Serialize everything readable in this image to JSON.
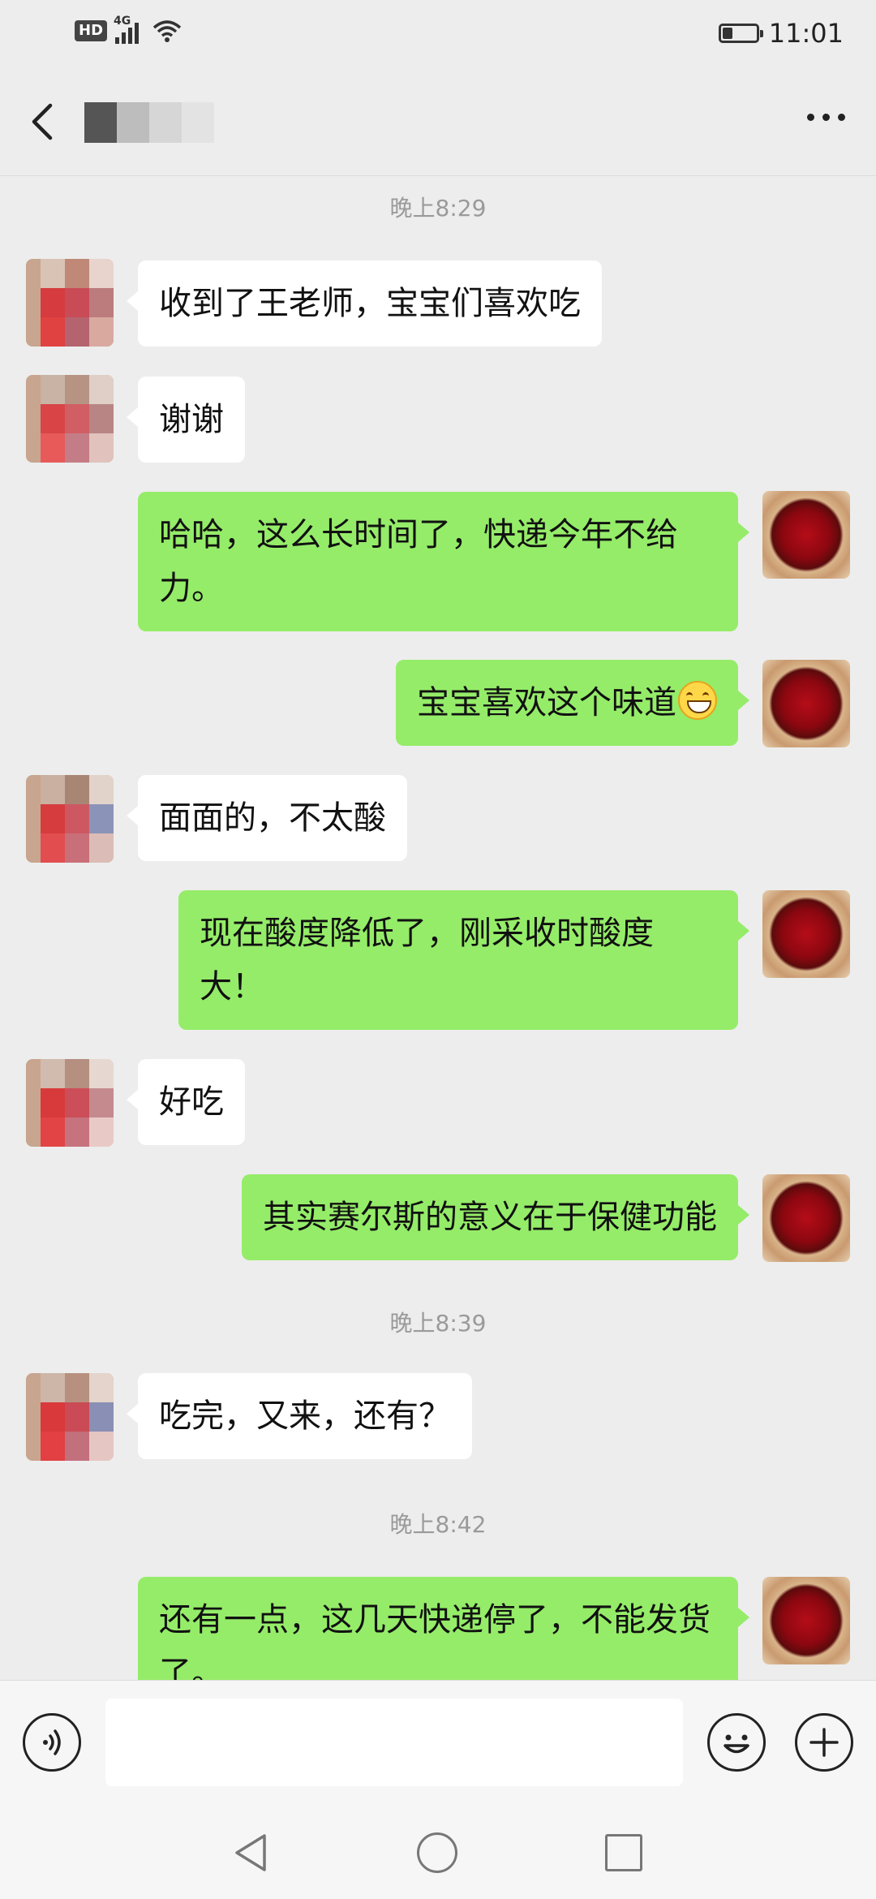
{
  "status_bar": {
    "hd_label": "HD",
    "network_label": "4G",
    "time": "11:01"
  },
  "header": {
    "back_icon": "chevron-left-icon",
    "more_icon": "more-dots-icon"
  },
  "colors": {
    "background": "#ededed",
    "sent_bubble": "#95ec69",
    "received_bubble": "#ffffff",
    "timestamp": "#9a9a9a"
  },
  "messages": [
    {
      "type": "timestamp",
      "text": "晚上8:29"
    },
    {
      "type": "received",
      "text": "收到了王老师，宝宝们喜欢吃"
    },
    {
      "type": "received",
      "text": "谢谢"
    },
    {
      "type": "sent",
      "text": "哈哈，这么长时间了，快递今年不给力。"
    },
    {
      "type": "sent",
      "text": "宝宝喜欢这个味道",
      "emoji": "grinning-face-emoji"
    },
    {
      "type": "received",
      "text": "面面的，不太酸"
    },
    {
      "type": "sent",
      "text": "现在酸度降低了，刚采收时酸度大！"
    },
    {
      "type": "received",
      "text": "好吃"
    },
    {
      "type": "sent",
      "text": "其实赛尔斯的意义在于保健功能"
    },
    {
      "type": "timestamp",
      "text": "晚上8:39"
    },
    {
      "type": "received",
      "text": "吃完，又来，还有？"
    },
    {
      "type": "timestamp",
      "text": "晚上8:42"
    },
    {
      "type": "sent",
      "text": "还有一点，这几天快递停了，不能发货了。"
    }
  ],
  "input_bar": {
    "voice_icon": "voice-icon",
    "input_value": "",
    "emoji_icon": "smiley-icon",
    "plus_icon": "plus-icon"
  },
  "nav_bar": {
    "back_icon": "triangle-back-icon",
    "home_icon": "circle-home-icon",
    "recent_icon": "square-recent-icon"
  }
}
